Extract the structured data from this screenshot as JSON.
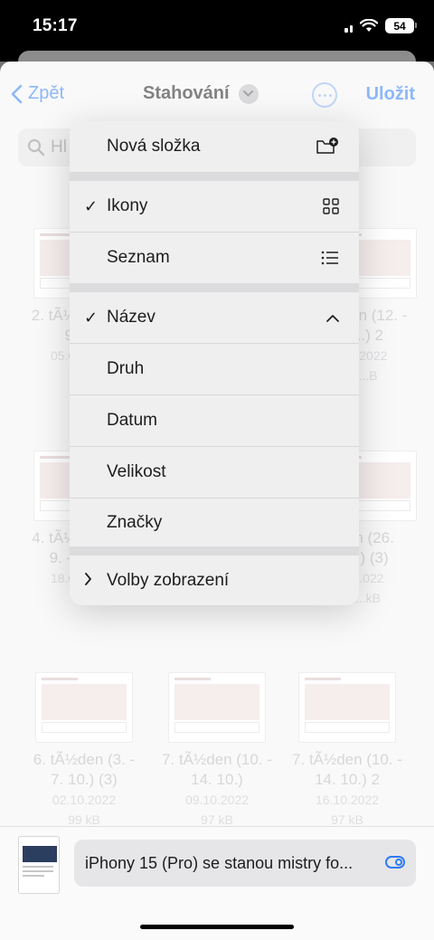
{
  "status": {
    "time": "15:17",
    "battery": "54"
  },
  "nav": {
    "back_label": "Zpět",
    "title": "Stahování",
    "save_label": "Uložit"
  },
  "search": {
    "placeholder_visible": "Hl"
  },
  "files": [
    {
      "name_lines": [
        "2. tÃ½den (5. -",
        "9. 9.)"
      ],
      "date": "05.09.2022",
      "size": ""
    },
    {
      "name_lines": [
        "",
        ""
      ],
      "date": "",
      "size": ""
    },
    {
      "name_lines": [
        "...den (12. -",
        "...) 2"
      ],
      "date": "...2022",
      "size": "...B"
    },
    {
      "name_lines": [
        "4. tÃ½den (19.",
        "9. - 23.9.)"
      ],
      "date": "18.09.2022",
      "size": ""
    },
    {
      "name_lines": [
        "",
        ""
      ],
      "date": "",
      "size": ""
    },
    {
      "name_lines": [
        "...n (26.",
        "...) (3)"
      ],
      "date": "...022",
      "size": "...kB"
    },
    {
      "name_lines": [
        "6. tÃ½den (3. -",
        "7. 10.) (3)"
      ],
      "date": "02.10.2022",
      "size": "99 kB"
    },
    {
      "name_lines": [
        "7. tÃ½den (10. -",
        "14. 10.)"
      ],
      "date": "09.10.2022",
      "size": "97 kB"
    },
    {
      "name_lines": [
        "7. tÃ½den (10. -",
        "14. 10.) 2"
      ],
      "date": "16.10.2022",
      "size": "97 kB"
    }
  ],
  "bottom": {
    "filename": "iPhony 15 (Pro) se stanou mistry fo..."
  },
  "menu": {
    "new_folder": "Nová složka",
    "icons": "Ikony",
    "list": "Seznam",
    "name": "Název",
    "kind": "Druh",
    "date": "Datum",
    "size": "Velikost",
    "tags": "Značky",
    "view_options": "Volby zobrazení"
  }
}
